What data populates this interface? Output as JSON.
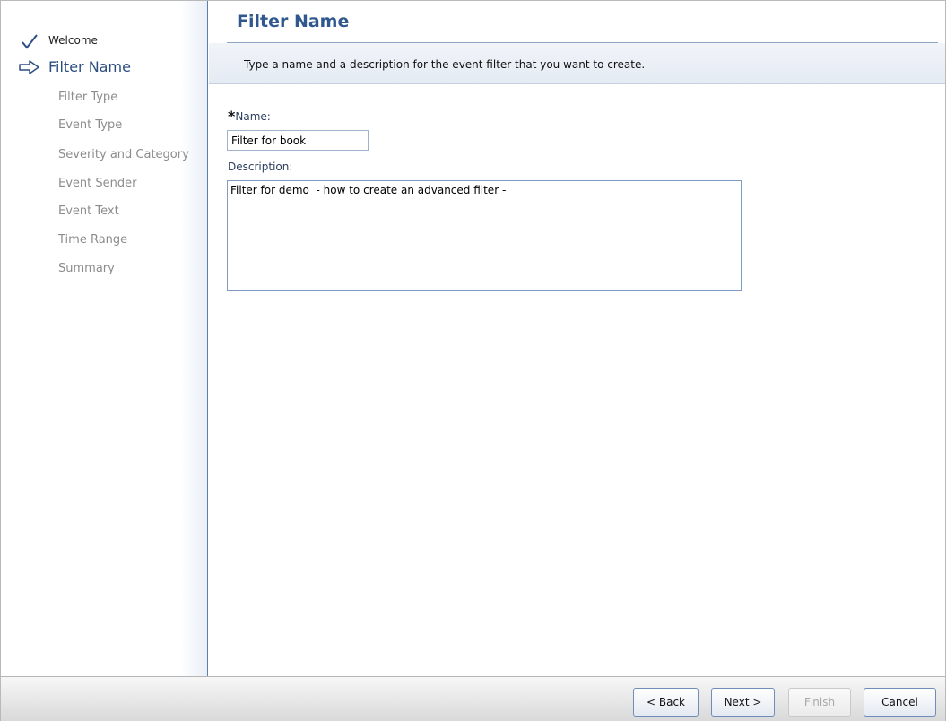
{
  "wizard": {
    "title": "Filter Name",
    "instruction": "Type a name and a description for the event filter that you want to create."
  },
  "steps": [
    {
      "label": "Welcome",
      "state": "done",
      "icon": "checkmark-icon"
    },
    {
      "label": "Filter Name",
      "state": "current",
      "icon": "arrow-right-icon"
    },
    {
      "label": "Filter Type",
      "state": "pending"
    },
    {
      "label": "Event Type",
      "state": "pending"
    },
    {
      "label": "Severity and Category",
      "state": "pending"
    },
    {
      "label": "Event Sender",
      "state": "pending"
    },
    {
      "label": "Event Text",
      "state": "pending"
    },
    {
      "label": "Time Range",
      "state": "pending"
    },
    {
      "label": "Summary",
      "state": "pending"
    }
  ],
  "form": {
    "required_marker": "*",
    "name_label": "Name:",
    "name_value": "Filter for book",
    "description_label": "Description:",
    "description_value": "Filter for demo  - how to create an advanced filter -"
  },
  "footer": {
    "back_label": "< Back",
    "next_label": "Next >",
    "finish_label": "Finish",
    "cancel_label": "Cancel"
  },
  "colors": {
    "title": "#30588e",
    "sidebar_border": "#5a7fb0",
    "checkmark": "#2c4e82"
  }
}
